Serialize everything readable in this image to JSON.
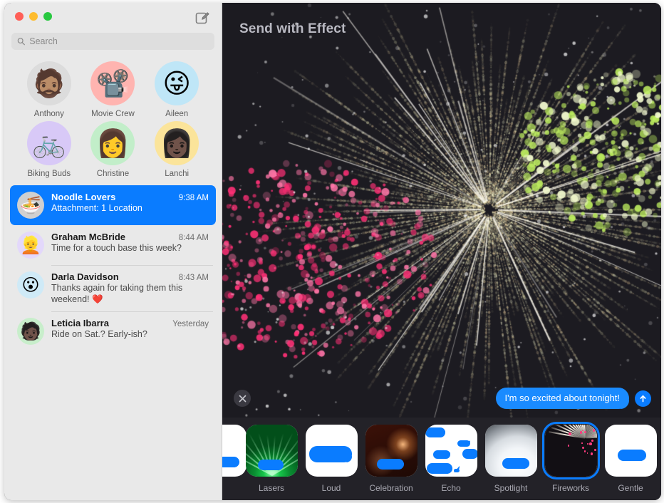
{
  "window": {
    "traffic_lights": [
      "close",
      "minimize",
      "zoom"
    ],
    "compose_icon": "compose-icon",
    "accent_color": "#0a7cff",
    "sidebar_bg": "#e9e9e9",
    "panel_bg": "#232228"
  },
  "search": {
    "placeholder": "Search",
    "value": "",
    "icon": "search-icon"
  },
  "pinned": [
    {
      "label": "Anthony",
      "glyph": "🧔🏽",
      "bg": "#dcdcdc"
    },
    {
      "label": "Movie Crew",
      "glyph": "📽️",
      "bg": "#ffb4b0"
    },
    {
      "label": "Aileen",
      "glyph": "😜",
      "bg": "#bfe6f7"
    },
    {
      "label": "Biking Buds",
      "glyph": "🚲",
      "bg": "#d8c9f7"
    },
    {
      "label": "Christine",
      "glyph": "👩",
      "bg": "#c2eec9"
    },
    {
      "label": "Lanchi",
      "glyph": "👩🏿",
      "bg": "#fbe49a"
    }
  ],
  "conversations": [
    {
      "name": "Noodle Lovers",
      "time": "9:38 AM",
      "snippet": "Attachment: 1 Location",
      "glyph": "🍜",
      "bg": "#d0d0d0",
      "selected": true
    },
    {
      "name": "Graham McBride",
      "time": "8:44 AM",
      "snippet": "Time for a touch base this week?",
      "glyph": "👱",
      "bg": "#e3d8fb",
      "selected": false
    },
    {
      "name": "Darla Davidson",
      "time": "8:43 AM",
      "snippet": "Thanks again for taking them this weekend! ❤️",
      "glyph": "😮",
      "bg": "#cfeaf7",
      "selected": false
    },
    {
      "name": "Leticia Ibarra",
      "time": "Yesterday",
      "snippet": "Ride on Sat.? Early-ish?",
      "glyph": "🧑🏿",
      "bg": "#c8eecb",
      "selected": false
    }
  ],
  "stage": {
    "title": "Send with Effect",
    "preview_effect": "Fireworks"
  },
  "message": {
    "close_icon": "close-icon",
    "text": "I'm so excited about tonight!",
    "send_icon": "send-arrow-icon",
    "bubble_color": "#1a8bff"
  },
  "effects": [
    {
      "label": "",
      "style": "partial",
      "selected": false
    },
    {
      "label": "Lasers",
      "style": "lasers",
      "selected": false
    },
    {
      "label": "Loud",
      "style": "loud",
      "selected": false
    },
    {
      "label": "Celebration",
      "style": "celebration",
      "selected": false
    },
    {
      "label": "Echo",
      "style": "echo",
      "selected": false
    },
    {
      "label": "Spotlight",
      "style": "spotlight",
      "selected": false
    },
    {
      "label": "Fireworks",
      "style": "fireworks",
      "selected": true
    },
    {
      "label": "Gentle",
      "style": "gentle",
      "selected": false
    }
  ]
}
